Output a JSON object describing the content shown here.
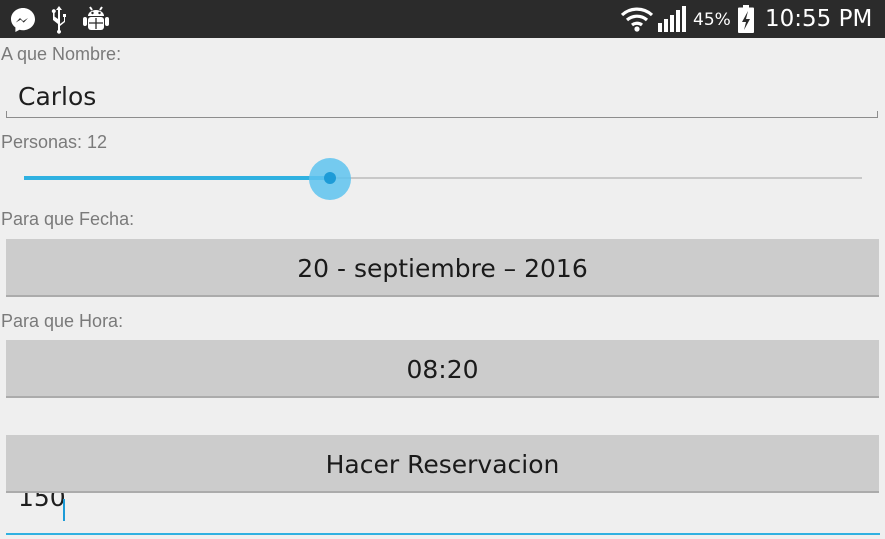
{
  "status_bar": {
    "icons": [
      "messenger-icon",
      "usb-icon",
      "android-debug-icon",
      "wifi-icon",
      "signal-icon",
      "battery-charging-icon"
    ],
    "battery_percent": "45%",
    "time": "10:55 PM"
  },
  "form": {
    "name_label": "A que Nombre:",
    "name_value": "Carlos",
    "persons_label": "Personas: 12",
    "persons_slider_fraction": 0.365,
    "date_label": "Para que Fecha:",
    "date_button": "20 - septiembre – 2016",
    "time_label": "Para que Hora:",
    "time_button": "08:20",
    "submit_button": "Hacer Reservacion",
    "bottom_field_value": "150"
  },
  "colors": {
    "accent": "#2fb1e1",
    "status_bar": "#2b2b2b",
    "background": "#efefef",
    "button": "#cccccc"
  }
}
